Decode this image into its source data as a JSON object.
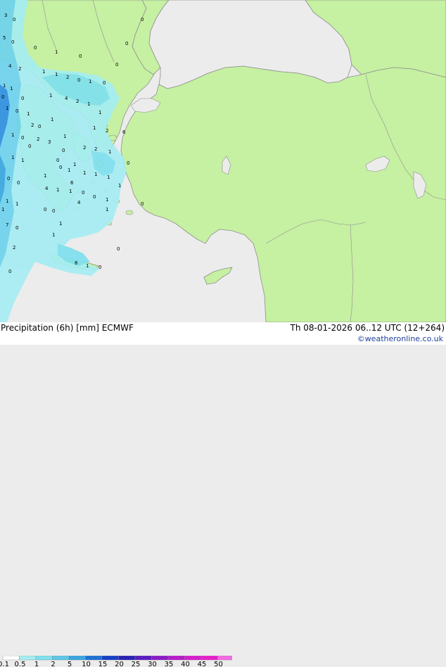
{
  "header": {
    "title": "Precipitation (6h) [mm] ECMWF",
    "valid_time": "Th 08-01-2026 06..12 UTC (12+264)"
  },
  "credit": "©weatheronline.co.uk",
  "legend": {
    "levels": [
      "0.1",
      "0.5",
      "1",
      "2",
      "5",
      "10",
      "15",
      "20",
      "25",
      "30",
      "35",
      "40",
      "45",
      "50"
    ],
    "colors": [
      "#ffffff",
      "#a5edf2",
      "#7fe0ee",
      "#5cc8e8",
      "#3aa6e0",
      "#1f72d6",
      "#1740c8",
      "#2a1fb6",
      "#5a1dc0",
      "#8a1cc8",
      "#b81ccd",
      "#d81dcf",
      "#e91fcd",
      "#f46be3"
    ]
  },
  "colors": {
    "sea": "#ececec",
    "land": "#c6f0a2",
    "coast": "#8f8f8f",
    "precip_light": "#a5edf2",
    "precip_medium": "#6fd3ec",
    "precip_heavy": "#2f8fe0"
  },
  "map_labels": [
    "3",
    "0",
    "5",
    "0",
    "0",
    "1",
    "0",
    "4",
    "2",
    "1",
    "1",
    "2",
    "0",
    "1",
    "0",
    "0",
    "1",
    "1",
    "1",
    "4",
    "2",
    "1",
    "1",
    "0",
    "1",
    "1",
    "1",
    "1",
    "2",
    "6",
    "1",
    "0",
    "2",
    "3",
    "2",
    "2",
    "0",
    "1",
    "1",
    "1",
    "1",
    "0",
    "1",
    "1",
    "1",
    "1",
    "0",
    "0",
    "4",
    "1",
    "1",
    "0",
    "0",
    "1",
    "1",
    "1",
    "0",
    "0",
    "0",
    "1",
    "7",
    "0",
    "1",
    "2",
    "8",
    "1",
    "0",
    "0",
    "0",
    "0",
    "0",
    "0",
    "1",
    "0",
    "0",
    "0",
    "1",
    "6",
    "4",
    "1",
    "0",
    "0",
    "2",
    "1",
    "1"
  ]
}
